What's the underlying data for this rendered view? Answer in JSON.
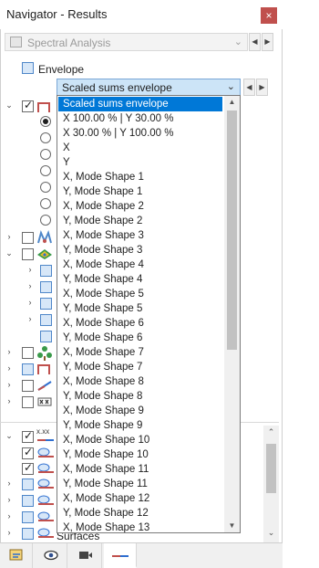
{
  "window": {
    "title": "Navigator - Results",
    "close_glyph": "×"
  },
  "header": {
    "loadcase_combo": "Spectral Analysis"
  },
  "envelope": {
    "label": "Envelope"
  },
  "combination_select": {
    "value": "Scaled sums envelope"
  },
  "dropdown_options": [
    "Scaled sums envelope",
    "X 100.00 % | Y 30.00 %",
    "X 30.00 % | Y 100.00 %",
    "X",
    "Y",
    "X, Mode Shape 1",
    "Y, Mode Shape 1",
    "X, Mode Shape 2",
    "Y, Mode Shape 2",
    "X, Mode Shape 3",
    "Y, Mode Shape 3",
    "X, Mode Shape 4",
    "Y, Mode Shape 4",
    "X, Mode Shape 5",
    "Y, Mode Shape 5",
    "X, Mode Shape 6",
    "Y, Mode Shape 6",
    "X, Mode Shape 7",
    "Y, Mode Shape 7",
    "X, Mode Shape 8",
    "Y, Mode Shape 8",
    "X, Mode Shape 9",
    "Y, Mode Shape 9",
    "X, Mode Shape 10",
    "Y, Mode Shape 10",
    "X, Mode Shape 11",
    "Y, Mode Shape 11",
    "X, Mode Shape 12",
    "Y, Mode Shape 12",
    "X, Mode Shape 13"
  ],
  "lower_tree": {
    "partial_label": "Surfaces",
    "xxx_icon_text": "x.xx"
  },
  "tabs": [
    "data-tab",
    "view-tab",
    "video-tab",
    "results-tab"
  ],
  "colors": {
    "accent": "#0078d7",
    "close": "#c0504d",
    "selected_combo": "#cce4f7"
  }
}
